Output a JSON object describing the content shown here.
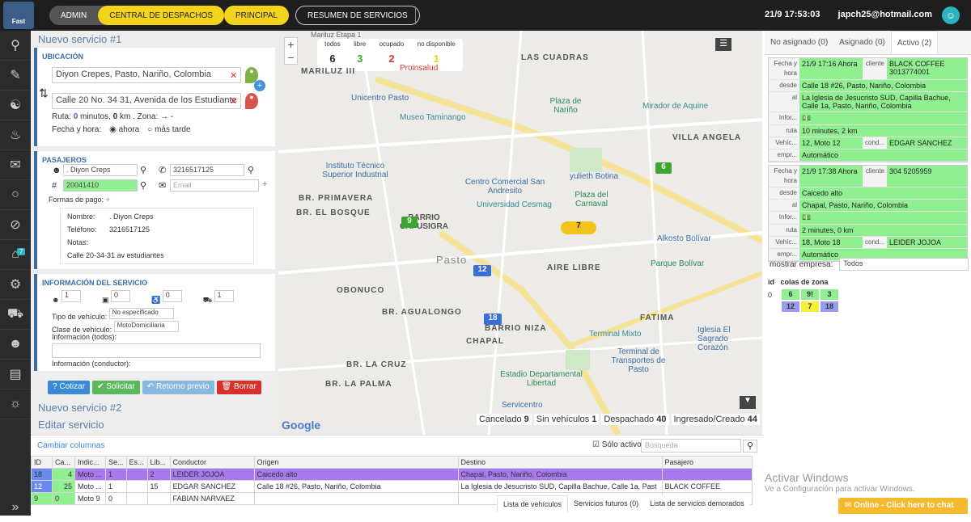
{
  "topbar": {
    "logo_text": "Fast",
    "admin": "ADMIN",
    "central": "CENTRAL DE DESPACHOS",
    "principal": "PRINCIPAL",
    "resumen": "RESUMEN DE SERVICIOS",
    "datetime": "21/9 17:53:03",
    "user": "japch25@hotmail.com"
  },
  "sidebar": {
    "icons": [
      "search-icon",
      "document-icon",
      "handshake-icon",
      "bell-icon",
      "chat-icon",
      "traffic-light-icon",
      "block-icon",
      "bank-icon",
      "gear-icon",
      "car-icon",
      "user-icon",
      "id-card-icon",
      "user-settings-icon"
    ],
    "badge": "7"
  },
  "left": {
    "title": "Nuevo servicio #1",
    "ubicacion_title": "UBICACIÓN",
    "origen": "Diyon Crepes, Pasto, Nariño, Colombia",
    "destino": "Calle 20 No. 34 31, Avenida de los Estudiante",
    "ruta_label": "Ruta:",
    "ruta_min": "0",
    "ruta_min_unit": "minutos,",
    "ruta_km": "0",
    "ruta_km_unit": "km . Zona: → -",
    "fecha_label": "Fecha y hora:",
    "ahora": "ahora",
    "mas_tarde": "más tarde",
    "pasajeros_title": "PASAJEROS",
    "pasajero_nombre": ". Diyon Creps",
    "pasajero_tel": "3216517125",
    "pasajero_id": "20041410",
    "email_ph": "Email",
    "formas_pago": "Formas de pago:",
    "nombre_label": "Nombre:",
    "nombre_val": ". Diyon Creps",
    "telefono_label": "Teléfono:",
    "telefono_val": "3216517125",
    "notas_label": "Notas:",
    "direccion_val": "Calle 20-34-31 av estudiantes",
    "info_title": "INFORMACIÓN DEL SERVICIO",
    "sel1": "1",
    "sel2": "0",
    "sel3": "0",
    "sel4": "1",
    "tipo_label": "Tipo de vehículo:",
    "tipo_val": "No especificado",
    "clase_label": "Clase de vehículo:",
    "clase_val": "MotoDomiciliaria",
    "info_todos": "Información (todos):",
    "info_conductor": "Información (conductor):",
    "btn_cotizar": "Cotizar",
    "btn_solicitar": "Solicitar",
    "btn_retorno": "Retorno previo",
    "btn_borrar": "Borrar",
    "nuevo2": "Nuevo servicio #2",
    "editar": "Editar servicio"
  },
  "map": {
    "counts": {
      "todos_label": "todos",
      "todos": "6",
      "libre_label": "libre",
      "libre": "3",
      "ocupado_label": "ocupado",
      "ocupado": "2",
      "nodisp_label": "no disponible",
      "nodisp": "1"
    },
    "places": [
      "LAS CUADRAS",
      "MARILUZ III",
      "Proinsalud",
      "Unicentro Pasto",
      "Museo Taminango",
      "Plaza de Nariño",
      "Mirador de Aquine",
      "VILLA ANGELA",
      "Instituto Técnico Superior Industrial",
      "Centro Comercial San Andresito",
      "yulieth Botina",
      "BR. PRIMAVERA",
      "BR. EL BOSQUE",
      "BARRIO CAPUSIGRA",
      "Universidad Cesmag",
      "Plaza del Carnaval",
      "Alkosto Bolívar",
      "Pasto",
      "AIRE LIBRE",
      "Parque Bolívar",
      "OBONUCO",
      "BR. AGUALONGO",
      "BARRIO NIZA",
      "FATIMA",
      "CHAPAL",
      "Terminal Mixto",
      "Iglesia El Sagrado Corazón",
      "Terminal de Transportes de Pasto",
      "BR. LA CRUZ",
      "BR. LA PALMA",
      "Estadio Departamental Libertad",
      "Servicentro",
      "Google",
      "Mariluz Etapa 1"
    ],
    "markers": [
      "6",
      "9",
      "7",
      "12",
      "18"
    ],
    "status": {
      "cancelado_label": "Cancelado",
      "cancelado": "9",
      "sin_label": "Sin vehículos",
      "sin": "1",
      "despachado_label": "Despachado",
      "despachado": "40",
      "ingresado_label": "Ingresado/Creado",
      "ingresado": "44"
    }
  },
  "right": {
    "tab1": "No asignado (0)",
    "tab2": "Asignado (0)",
    "tab3": "Activo (2)",
    "services": [
      {
        "fecha": "21/9 17:16 Ahora",
        "cliente_label": "cliente",
        "cliente": "BLACK COFFEE 3013774001",
        "desde": "Calle 18 #26, Pasto, Nariño, Colombia",
        "al": "La Iglesia de Jesucristo SUD, Capilla Bachue, Calle 1a, Pasto, Nariño, Colombia",
        "ruta": "10 minutes, 2 km",
        "vehiculo": "12, Moto 12",
        "cond_label": "cond...",
        "conductor": "EDGAR SANCHEZ",
        "empresa": "Automático"
      },
      {
        "fecha": "21/9 17:38 Ahora",
        "cliente_label": "cliente",
        "cliente": "304 5205959",
        "desde": "Caicedo alto",
        "al": "Chapal, Pasto, Nariño, Colombia",
        "ruta": "2 minutes, 0 km",
        "vehiculo": "18, Moto 18",
        "cond_label": "cond...",
        "conductor": "LEIDER JOJOA",
        "empresa": "Automático"
      }
    ],
    "labels": {
      "fecha": "Fecha y hora",
      "desde": "desde",
      "al": "al",
      "info": "Infor...",
      "ruta": "ruta",
      "vehiculo": "Vehíc...",
      "empresa": "empr..."
    },
    "mostrar_label": "mostrar empresa:",
    "mostrar_val": "Todos",
    "id_label": "id",
    "colas_label": "colas de zona",
    "zone_id": "0",
    "zones": [
      "6",
      "9!",
      "3",
      "12",
      "7",
      "18"
    ],
    "activar1": "Activar Windows",
    "activar2": "Ve a Configuración para activar Windows.",
    "chat": "Online - Click here to chat"
  },
  "bottom": {
    "cambiar": "Cambiar columnas",
    "solo_activo": "Sólo activo",
    "busqueda_ph": "Búsqueda",
    "headers": [
      "ID",
      "Ca...",
      "Indic...",
      "Se...",
      "Es...",
      "Lib...",
      "Conductor",
      "Origen",
      "Destino",
      "Pasajero"
    ],
    "rows": [
      [
        "18",
        "4",
        "Moto ...",
        "1",
        "",
        "2",
        "LEIDER JOJOA",
        "Caicedo alto",
        "Chapal, Pasto, Nariño, Colombia",
        ""
      ],
      [
        "12",
        "25",
        "Moto ...",
        "1",
        "",
        "15",
        "EDGAR SANCHEZ",
        "Calle 18 #26, Pasto, Nariño, Colombia",
        "La Iglesia de Jesucristo SUD, Capilla Bachue, Calle 1a, Past",
        "BLACK COFFEE"
      ],
      [
        "9",
        "0",
        "Moto 9",
        "0",
        "",
        "",
        "FABIAN NARVAEZ",
        "",
        "",
        ""
      ]
    ],
    "tabs": [
      "Lista de vehículos",
      "Servicios futuros (0)",
      "Lista de servicios demorados"
    ]
  }
}
